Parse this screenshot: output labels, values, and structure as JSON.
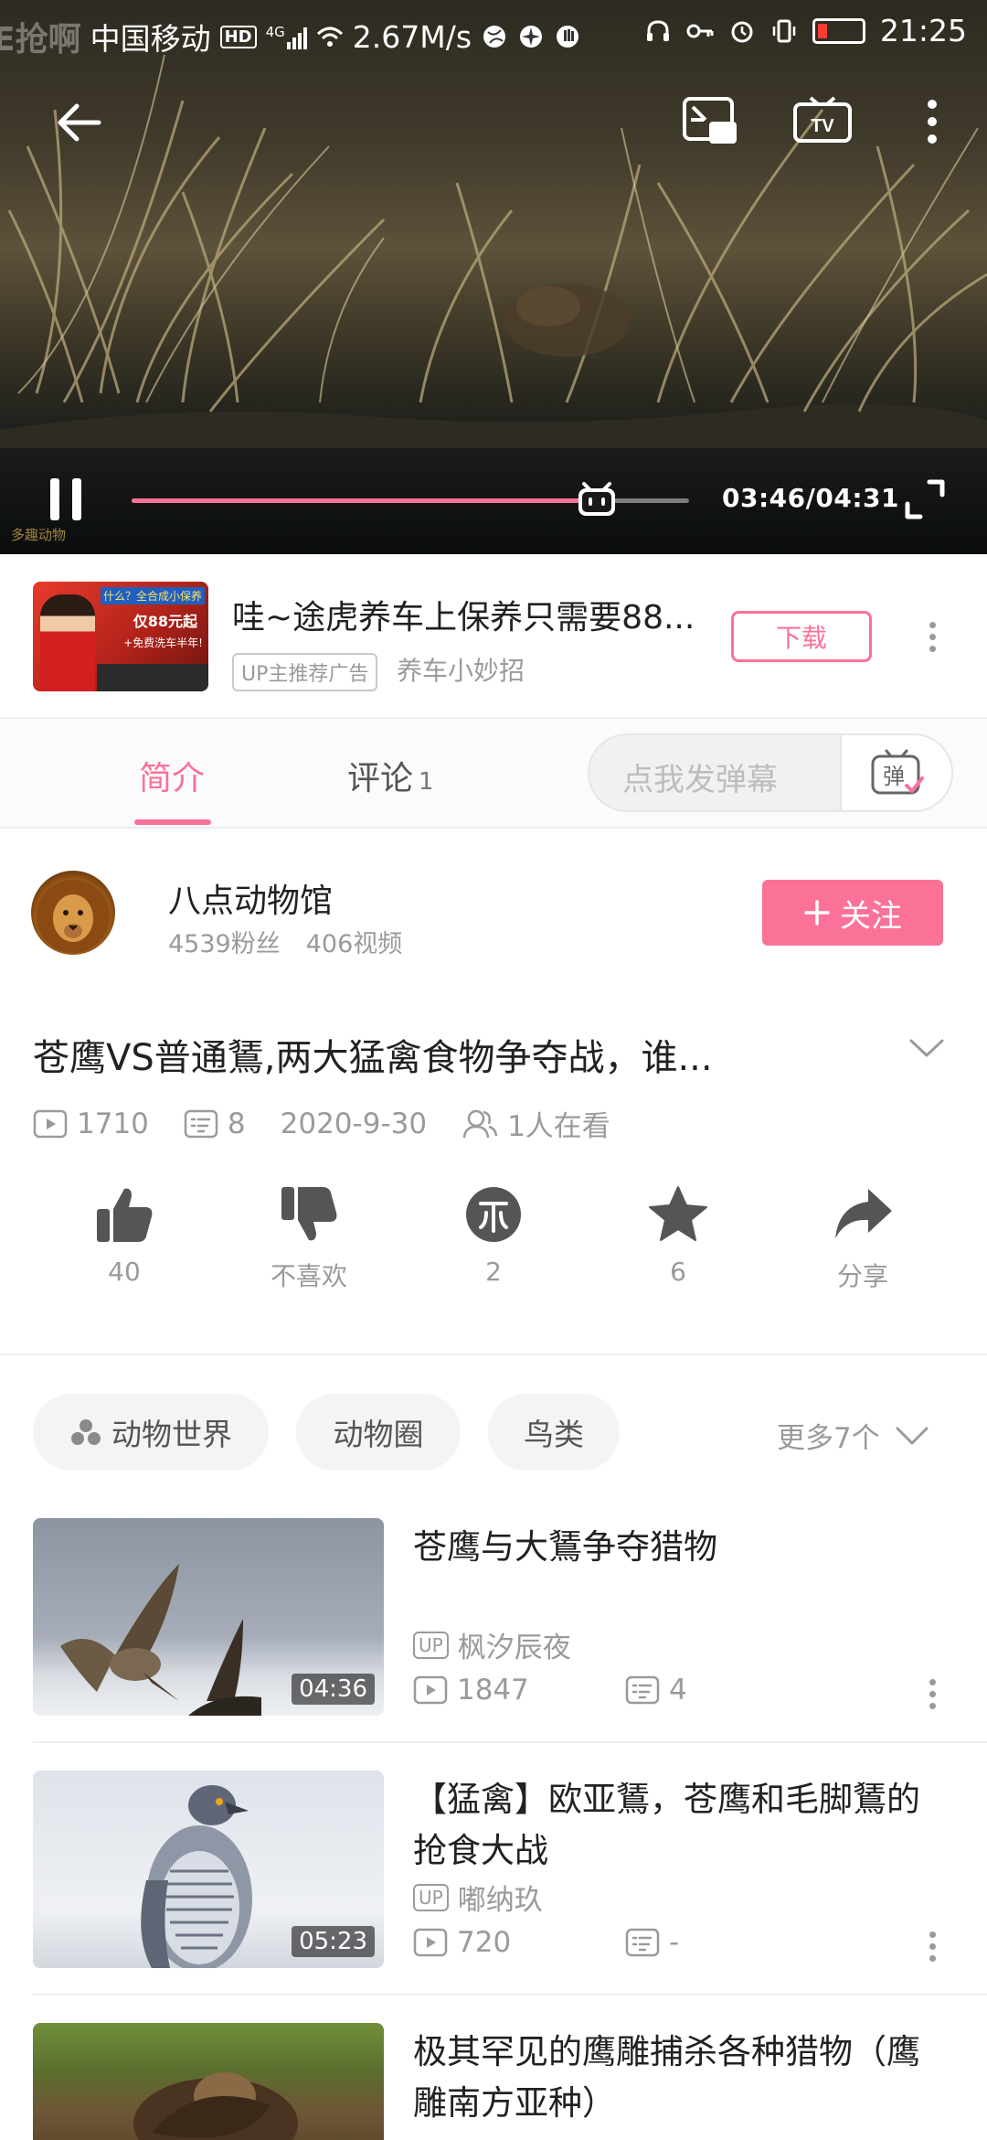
{
  "status_bar": {
    "ghost_text": "E抢啊",
    "carrier": "中国移动",
    "hd": "HD",
    "net": "4G",
    "speed": "2.67M/s",
    "time": "21:25"
  },
  "player": {
    "time_display": "03:46/04:31",
    "progress_fraction": 0.834,
    "watermark": "多趣动物"
  },
  "ad": {
    "title": "哇~途虎养车上保养只需要88...",
    "tag": "UP主推荐广告",
    "source": "养车小妙招",
    "download_label": "下载",
    "thumb_text_1": "什么？全合成小保养",
    "thumb_text_2": "仅88元起",
    "thumb_text_3": "+免费洗车半年!"
  },
  "tabs": {
    "intro": "简介",
    "comments": "评论",
    "comments_count": "1",
    "danmaku_placeholder": "点我发弹幕",
    "danmaku_icon_char": "弹"
  },
  "uploader": {
    "name": "八点动物馆",
    "fans": "4539粉丝",
    "videos": "406视频",
    "follow_label": "关注"
  },
  "video": {
    "title": "苍鹰VS普通鵟,两大猛禽食物争夺战，谁...",
    "views": "1710",
    "danmaku_count": "8",
    "date": "2020-9-30",
    "watching": "1人在看"
  },
  "actions": [
    {
      "label": "40"
    },
    {
      "label": "不喜欢"
    },
    {
      "label": "2"
    },
    {
      "label": "6"
    },
    {
      "label": "分享"
    }
  ],
  "tags": [
    "动物世界",
    "动物圈",
    "鸟类"
  ],
  "more_tags": "更多7个",
  "related": [
    {
      "title": "苍鹰与大鵟争夺猎物",
      "up": "枫汐辰夜",
      "views": "1847",
      "danmaku": "4",
      "duration": "04:36"
    },
    {
      "title": "【猛禽】欧亚鵟，苍鹰和毛脚鵟的抢食大战",
      "up": "嘟纳玖",
      "views": "720",
      "danmaku": "-",
      "duration": "05:23"
    },
    {
      "title": "极其罕见的鹰雕捕杀各种猎物（鹰雕南方亚种）",
      "up": "",
      "views": "",
      "danmaku": "",
      "duration": ""
    }
  ],
  "up_badge": "UP",
  "colors": {
    "accent": "#fb7299",
    "muted": "#9a9a9a"
  }
}
